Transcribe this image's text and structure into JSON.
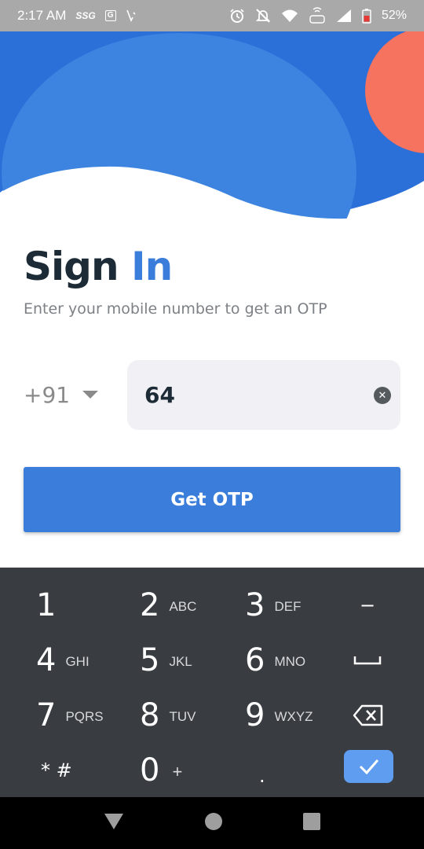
{
  "status_bar": {
    "time": "2:17 AM",
    "carrier_badge": "SSG",
    "box_badge": "G",
    "battery": "52%",
    "icons": [
      "alarm-icon",
      "mute-icon",
      "wifi-icon",
      "volte-icon",
      "signal-icon",
      "battery-icon"
    ]
  },
  "signin": {
    "title_main": "Sign",
    "title_accent": "In",
    "subtitle": "Enter your mobile number to get an OTP"
  },
  "phone": {
    "country_code": "+91",
    "value": "64"
  },
  "button": {
    "label": "Get OTP"
  },
  "colors": {
    "primary": "#3a7ddb",
    "header_blue": "#2b6fd9",
    "coral": "#f5735f",
    "keyboard_bg": "#393d41",
    "title_dark": "#1c2b36"
  },
  "keyboard": {
    "keys": [
      {
        "digit": "1",
        "letters": ""
      },
      {
        "digit": "2",
        "letters": "ABC"
      },
      {
        "digit": "3",
        "letters": "DEF"
      },
      {
        "digit": "−",
        "letters": ""
      },
      {
        "digit": "4",
        "letters": "GHI"
      },
      {
        "digit": "5",
        "letters": "JKL"
      },
      {
        "digit": "6",
        "letters": "MNO"
      },
      {
        "digit": "␣",
        "letters": ""
      },
      {
        "digit": "7",
        "letters": "PQRS"
      },
      {
        "digit": "8",
        "letters": "TUV"
      },
      {
        "digit": "9",
        "letters": "WXYZ"
      },
      {
        "digit": "⌫",
        "letters": ""
      },
      {
        "digit": "* #",
        "letters": ""
      },
      {
        "digit": "0",
        "letters": "+"
      },
      {
        "digit": ".",
        "letters": ""
      },
      {
        "digit": "✓",
        "letters": ""
      }
    ]
  },
  "nav": {
    "icons": [
      "back-icon",
      "home-icon",
      "recents-icon"
    ]
  }
}
